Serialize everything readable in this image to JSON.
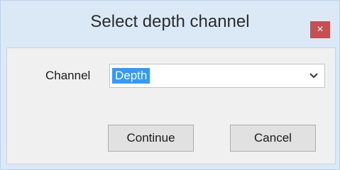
{
  "dialog": {
    "title": "Select depth channel",
    "close_label": "×",
    "channel_label": "Channel",
    "channel_value": "Depth",
    "continue_label": "Continue",
    "cancel_label": "Cancel"
  },
  "icons": {
    "close": "close-icon",
    "dropdown": "chevron-down-icon"
  },
  "colors": {
    "titlebar": "#dbe8f6",
    "close_button": "#c74f4f",
    "selection": "#3399ff",
    "client": "#f0f0f0"
  }
}
